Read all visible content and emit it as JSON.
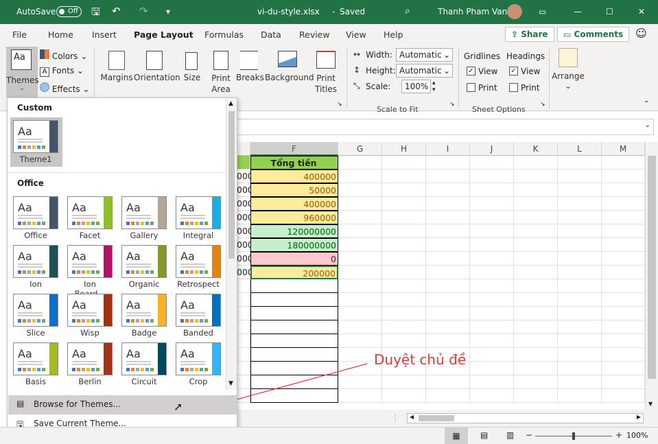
{
  "titlebar": {
    "autosave": "AutoSave",
    "toggle": "Off",
    "filename": "vi-du-style.xlsx",
    "saved": "Saved",
    "user": "Thanh Pham Van"
  },
  "tabs": [
    "File",
    "Home",
    "Insert",
    "Page Layout",
    "Formulas",
    "Data",
    "Review",
    "View",
    "Help"
  ],
  "share": "Share",
  "comments": "Comments",
  "ribbon": {
    "themes": "Themes",
    "colors": "Colors",
    "fonts": "Fonts",
    "effects": "Effects",
    "margins": "Margins",
    "orientation": "Orientation",
    "size": "Size",
    "print_area": "Print Area",
    "breaks": "Breaks",
    "background": "Background",
    "print_titles": "Print Titles",
    "width_label": "Width:",
    "width_value": "Automatic",
    "height_label": "Height:",
    "height_value": "Automatic",
    "scale_label": "Scale:",
    "scale_value": "100%",
    "scale_to_fit": "Scale to Fit",
    "gridlines": "Gridlines",
    "headings": "Headings",
    "view": "View",
    "print": "Print",
    "sheet_options": "Sheet Options",
    "arrange": "Arrange"
  },
  "columns": [
    "F",
    "G",
    "H",
    "I",
    "J",
    "K",
    "L",
    "M"
  ],
  "header_cell": "Tổng tiền",
  "rows": [
    {
      "e": "000",
      "f": "400000",
      "type": "yellow"
    },
    {
      "e": "000",
      "f": "50000",
      "type": "yellow"
    },
    {
      "e": "000",
      "f": "400000",
      "type": "yellow"
    },
    {
      "e": "000",
      "f": "960000",
      "type": "yellow"
    },
    {
      "e": "000",
      "f": "120000000",
      "type": "green"
    },
    {
      "e": "000",
      "f": "180000000",
      "type": "green"
    },
    {
      "e": "000",
      "f": "0",
      "type": "red"
    },
    {
      "e": "000",
      "f": "200000",
      "type": "yellow"
    }
  ],
  "gallery": {
    "custom": "Custom",
    "custom_themes": [
      {
        "name": "Theme1",
        "accent": "#44546a"
      }
    ],
    "office": "Office",
    "themes": [
      {
        "name": "Office",
        "accent": "#44546a"
      },
      {
        "name": "Facet",
        "accent": "#90c226"
      },
      {
        "name": "Gallery",
        "accent": "#b4a59a"
      },
      {
        "name": "Integral",
        "accent": "#1cade4"
      },
      {
        "name": "Ion",
        "accent": "#1e5155"
      },
      {
        "name": "Ion Board...",
        "accent": "#b31166"
      },
      {
        "name": "Organic",
        "accent": "#83992a"
      },
      {
        "name": "Retrospect",
        "accent": "#e48312"
      },
      {
        "name": "Slice",
        "accent": "#0f6fc6"
      },
      {
        "name": "Wisp",
        "accent": "#a53010"
      },
      {
        "name": "Badge",
        "accent": "#f8b323"
      },
      {
        "name": "Banded",
        "accent": "#0070c0"
      },
      {
        "name": "Basis",
        "accent": "#a6b727"
      },
      {
        "name": "Berlin",
        "accent": "#a6321a"
      },
      {
        "name": "Circuit",
        "accent": "#03485e"
      },
      {
        "name": "Crop",
        "accent": "#31b6fd"
      }
    ],
    "browse": "Browse for Themes...",
    "save": "Save Current Theme..."
  },
  "annotation": "Duyệt chủ đề",
  "zoom": "100%"
}
